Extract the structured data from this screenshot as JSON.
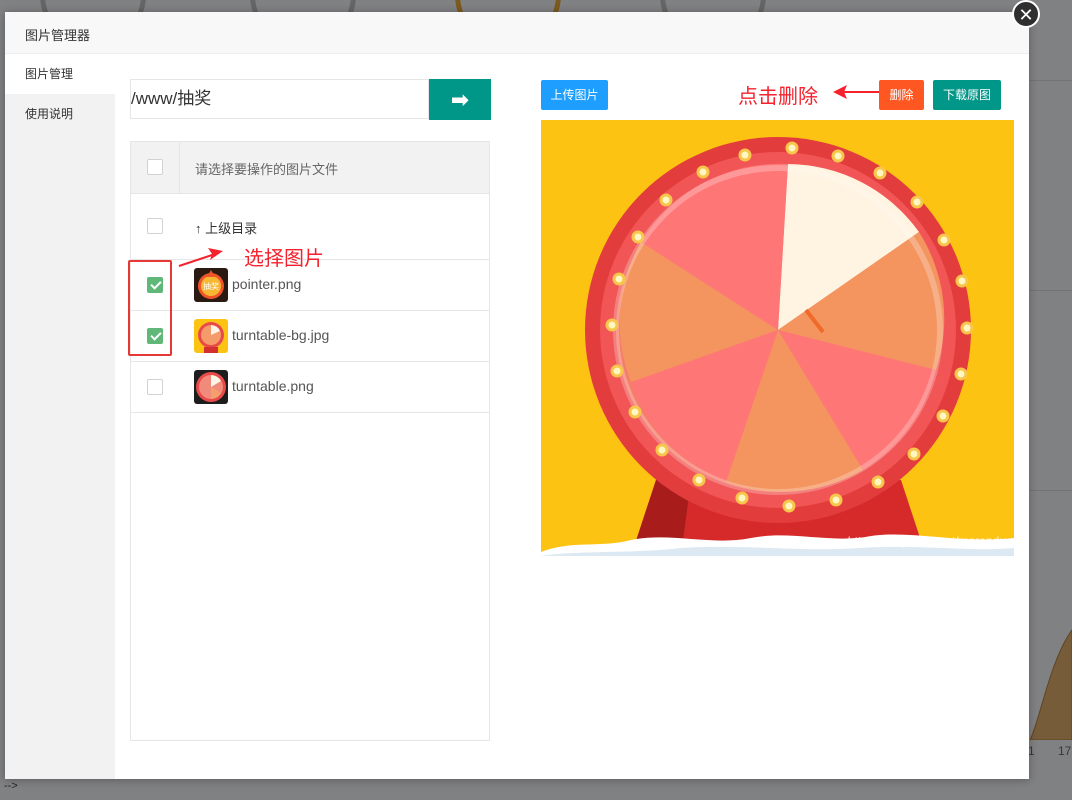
{
  "background": {
    "chart_tick_labels": [
      "1",
      "17"
    ],
    "comment_text": "-->"
  },
  "modal": {
    "title": "图片管理器",
    "close_glyph": "✕"
  },
  "sidebar": {
    "items": [
      {
        "label": "图片管理",
        "active": true
      },
      {
        "label": "使用说明",
        "active": false
      }
    ]
  },
  "path": {
    "value": "/www/抽奖",
    "go_glyph": "➡"
  },
  "file_list": {
    "header": "请选择要操作的图片文件",
    "parent_dir_label": "↑ 上级目录",
    "files": [
      {
        "name": "pointer.png",
        "checked": true
      },
      {
        "name": "turntable-bg.jpg",
        "checked": true
      },
      {
        "name": "turntable.png",
        "checked": false
      }
    ],
    "thumb_text": "抽奖"
  },
  "toolbar": {
    "upload_label": "上传图片",
    "delete_label": "删除",
    "download_label": "下载原图"
  },
  "preview": {
    "watermark": "https://blog.csdn.net/marendu"
  },
  "annotations": {
    "delete_hint": "点击删除",
    "select_hint": "选择图片"
  },
  "colors": {
    "primary_green": "#009688",
    "upload_blue": "#1e9fff",
    "delete_orange": "#ff5722",
    "check_green": "#5fb878",
    "annotation_red": "#f5222d",
    "preview_bg": "#fdc312"
  }
}
